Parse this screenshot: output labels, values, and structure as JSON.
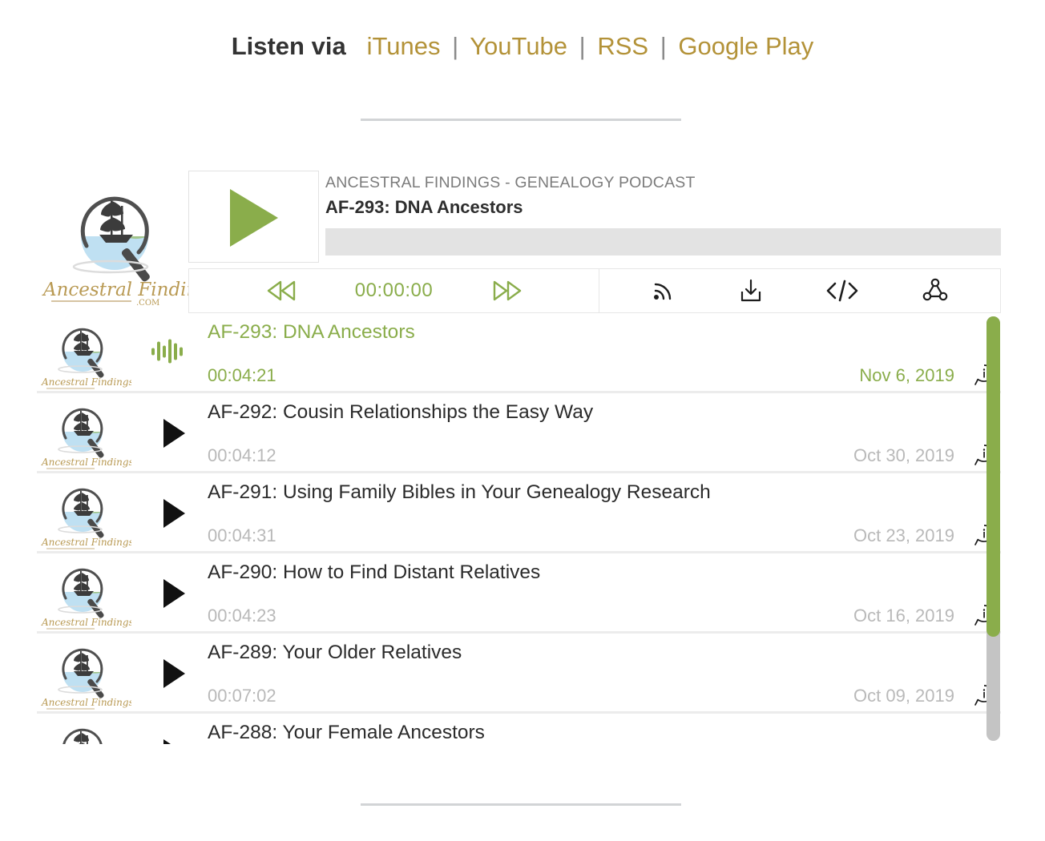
{
  "listen": {
    "label": "Listen via",
    "links": [
      {
        "text": "iTunes",
        "name": "itunes"
      },
      {
        "text": "YouTube",
        "name": "youtube"
      },
      {
        "text": "RSS",
        "name": "rss"
      },
      {
        "text": "Google Play",
        "name": "google-play"
      }
    ],
    "separator": "|"
  },
  "player": {
    "show_name": "ANCESTRAL FINDINGS - GENEALOGY PODCAST",
    "current_title": "AF-293: DNA Ancestors",
    "current_time": "00:00:00",
    "progress_percent": 0,
    "logo_text_main": "Ancestral Findings",
    "logo_text_sub": ".COM",
    "icons": {
      "play": "play-icon",
      "rewind": "rewind-icon",
      "forward": "fast-forward-icon",
      "subscribe": "rss-icon",
      "download": "download-icon",
      "embed": "embed-code-icon",
      "share": "share-icon"
    },
    "embed_label": "</>"
  },
  "playlist": {
    "tracks": [
      {
        "title": "AF-293: DNA Ancestors",
        "duration": "00:04:21",
        "date": "Nov 6, 2019",
        "active": true
      },
      {
        "title": "AF-292: Cousin Relationships the Easy Way",
        "duration": "00:04:12",
        "date": "Oct 30, 2019",
        "active": false
      },
      {
        "title": "AF-291: Using Family Bibles in Your Genealogy Research",
        "duration": "00:04:31",
        "date": "Oct 23, 2019",
        "active": false
      },
      {
        "title": "AF-290: How to Find Distant Relatives",
        "duration": "00:04:23",
        "date": "Oct 16, 2019",
        "active": false
      },
      {
        "title": "AF-289: Your Older Relatives",
        "duration": "00:07:02",
        "date": "Oct 09, 2019",
        "active": false
      },
      {
        "title": "AF-288: Your Female Ancestors",
        "duration": "",
        "date": "",
        "active": false
      }
    ]
  },
  "colors": {
    "accent_green": "#8aad4b",
    "link_gold": "#b39238",
    "muted_gray": "#b9b9b9",
    "divider": "#d2d4d6"
  }
}
